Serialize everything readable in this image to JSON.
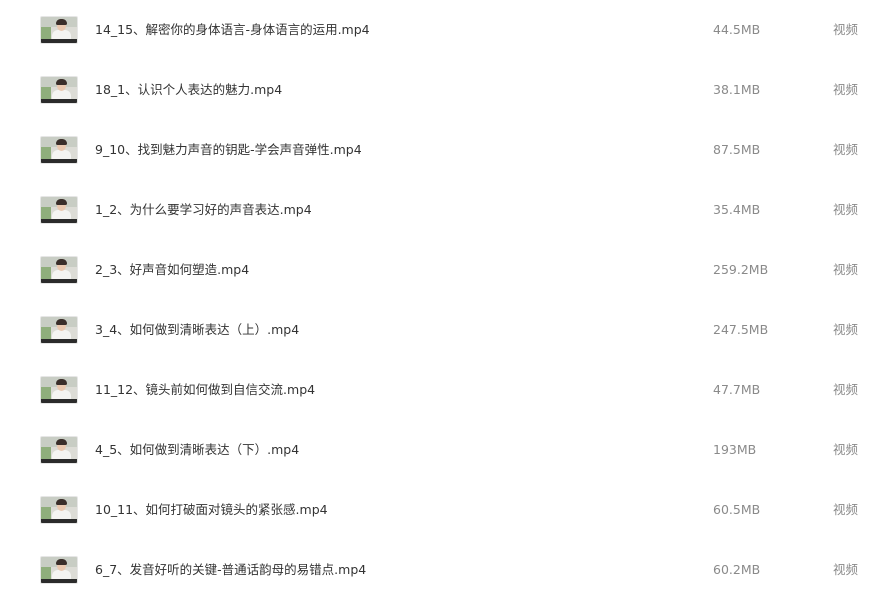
{
  "files": [
    {
      "name": "14_15、解密你的身体语言-身体语言的运用.mp4",
      "size": "44.5MB",
      "type": "视频",
      "thumb_icon": "video-thumbnail-icon"
    },
    {
      "name": "18_1、认识个人表达的魅力.mp4",
      "size": "38.1MB",
      "type": "视频",
      "thumb_icon": "video-thumbnail-icon"
    },
    {
      "name": "9_10、找到魅力声音的钥匙-学会声音弹性.mp4",
      "size": "87.5MB",
      "type": "视频",
      "thumb_icon": "video-thumbnail-icon"
    },
    {
      "name": "1_2、为什么要学习好的声音表达.mp4",
      "size": "35.4MB",
      "type": "视频",
      "thumb_icon": "video-thumbnail-icon"
    },
    {
      "name": "2_3、好声音如何塑造.mp4",
      "size": "259.2MB",
      "type": "视频",
      "thumb_icon": "video-thumbnail-icon"
    },
    {
      "name": "3_4、如何做到清晰表达（上）.mp4",
      "size": "247.5MB",
      "type": "视频",
      "thumb_icon": "video-thumbnail-icon"
    },
    {
      "name": "11_12、镜头前如何做到自信交流.mp4",
      "size": "47.7MB",
      "type": "视频",
      "thumb_icon": "video-thumbnail-icon"
    },
    {
      "name": "4_5、如何做到清晰表达（下）.mp4",
      "size": "193MB",
      "type": "视频",
      "thumb_icon": "video-thumbnail-icon"
    },
    {
      "name": "10_11、如何打破面对镜头的紧张感.mp4",
      "size": "60.5MB",
      "type": "视频",
      "thumb_icon": "video-thumbnail-icon"
    },
    {
      "name": "6_7、发音好听的关键-普通话韵母的易错点.mp4",
      "size": "60.2MB",
      "type": "视频",
      "thumb_icon": "video-thumbnail-icon"
    }
  ],
  "colors": {
    "name_text": "#333333",
    "meta_text": "#8a8a8a",
    "background": "#ffffff"
  }
}
